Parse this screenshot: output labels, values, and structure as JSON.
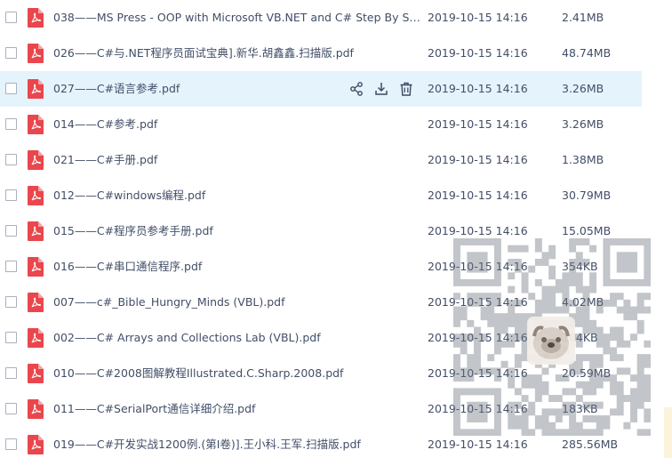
{
  "file_list": {
    "hovered_index": 2,
    "row_actions": {
      "icons": [
        "share-icon",
        "download-icon",
        "delete-icon"
      ]
    },
    "colors": {
      "pdf_icon": "#e9474d",
      "hover_row": "#e5f3fc",
      "text": "#424e67"
    },
    "rows": [
      {
        "name": "038——MS Press - OOP with Microsoft VB.NET and C# Step By St...",
        "date": "2019-10-15 14:16",
        "size": "2.41MB"
      },
      {
        "name": "026——C#与.NET程序员面试宝典].新华.胡鑫鑫.扫描版.pdf",
        "date": "2019-10-15 14:16",
        "size": "48.74MB"
      },
      {
        "name": "027——C#语言参考.pdf",
        "date": "2019-10-15 14:16",
        "size": "3.26MB"
      },
      {
        "name": "014——C#参考.pdf",
        "date": "2019-10-15 14:16",
        "size": "3.26MB"
      },
      {
        "name": "021——C#手册.pdf",
        "date": "2019-10-15 14:16",
        "size": "1.38MB"
      },
      {
        "name": "012——C#windows编程.pdf",
        "date": "2019-10-15 14:16",
        "size": "30.79MB"
      },
      {
        "name": "015——C#程序员参考手册.pdf",
        "date": "2019-10-15 14:16",
        "size": "15.05MB"
      },
      {
        "name": "016——C#串口通信程序.pdf",
        "date": "2019-10-15 14:16",
        "size": "354KB"
      },
      {
        "name": "007——c#_Bible_Hungry_Minds (VBL).pdf",
        "date": "2019-10-15 14:16",
        "size": "4.02MB"
      },
      {
        "name": "002——C# Arrays and Collections Lab (VBL).pdf",
        "date": "2019-10-15 14:16",
        "size": "104KB"
      },
      {
        "name": "010——C#2008图解教程Illustrated.C.Sharp.2008.pdf",
        "date": "2019-10-15 14:16",
        "size": "20.59MB"
      },
      {
        "name": "011——C#SerialPort通信详细介绍.pdf",
        "date": "2019-10-15 14:16",
        "size": "183KB"
      },
      {
        "name": "019——C#开发实战1200例.(第Ⅰ卷)].王小科.王军.扫描版.pdf",
        "date": "2019-10-15 14:16",
        "size": "285.56MB"
      }
    ]
  }
}
